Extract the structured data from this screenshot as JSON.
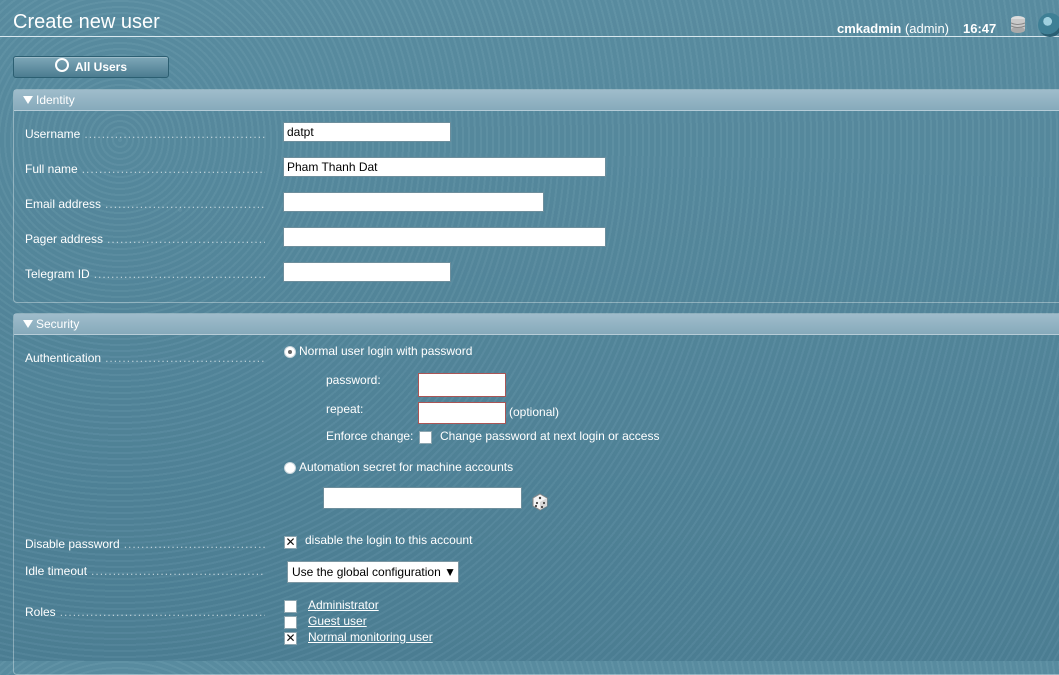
{
  "header": {
    "title": "Create new user",
    "username": "cmkadmin",
    "role": "(admin)",
    "time": "16:47"
  },
  "nav": {
    "back_label": "All Users"
  },
  "identity": {
    "section_title": "Identity",
    "username_label": "Username",
    "username_value": "datpt",
    "fullname_label": "Full name",
    "fullname_value": "Pham Thanh Dat",
    "email_label": "Email address",
    "email_value": "",
    "pager_label": "Pager address",
    "pager_value": "",
    "telegram_label": "Telegram ID",
    "telegram_value": ""
  },
  "security": {
    "section_title": "Security",
    "auth_label": "Authentication",
    "auth_option_password": "Normal user login with password",
    "password_label": "password:",
    "repeat_label": "repeat:",
    "optional_text": "(optional)",
    "enforce_label": "Enforce change:",
    "enforce_text": "Change password at next login or access",
    "auth_option_automation": "Automation secret for machine accounts",
    "disable_label": "Disable password",
    "disable_text": "disable the login to this account",
    "idle_label": "Idle timeout",
    "idle_value": "Use the global configuration ▼",
    "roles_label": "Roles",
    "roles": [
      "Administrator",
      "Guest user",
      "Normal monitoring user"
    ],
    "roles_checked": [
      false,
      false,
      true
    ]
  }
}
